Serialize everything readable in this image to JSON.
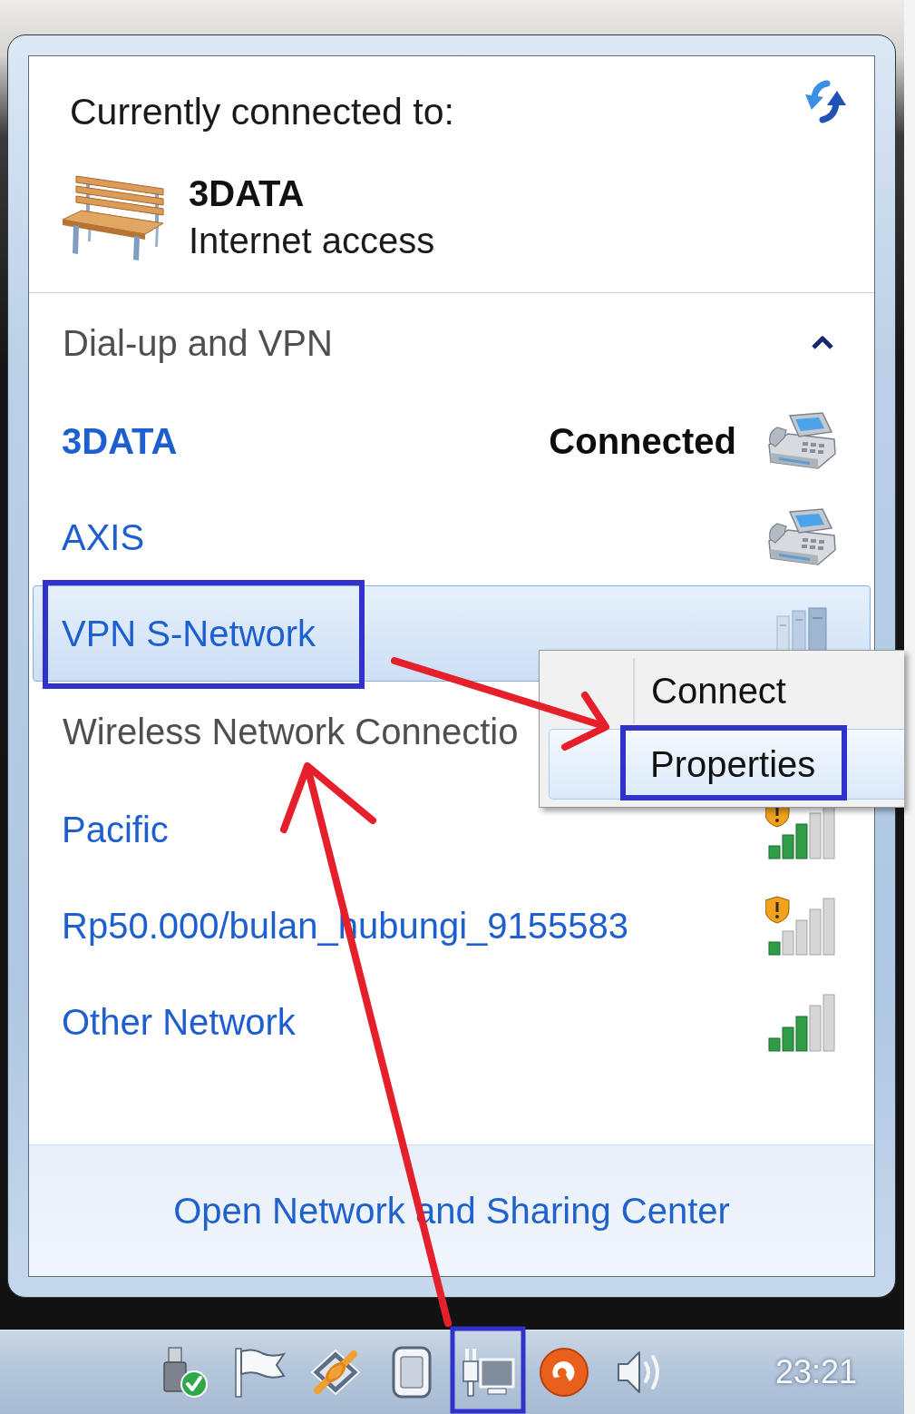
{
  "flyout": {
    "heading": "Currently connected to:",
    "current_connection": {
      "name": "3DATA",
      "access": "Internet access"
    },
    "sections": [
      {
        "title": "Dial-up and VPN",
        "expanded": true,
        "items": [
          {
            "kind": "dialup",
            "name": "3DATA",
            "connected": true,
            "status": "Connected",
            "selected": false
          },
          {
            "kind": "dialup",
            "name": "AXIS",
            "connected": false,
            "selected": false
          },
          {
            "kind": "vpn",
            "name": "VPN S-Network",
            "connected": false,
            "selected": true
          }
        ]
      },
      {
        "title": "Wireless Network Connectio",
        "items": [
          {
            "kind": "wifi-medium",
            "name": "Pacific",
            "connected": false,
            "selected": false,
            "unsecured": true
          },
          {
            "kind": "wifi-low",
            "name": "Rp50.000/bulan_hubungi_9155583",
            "connected": false,
            "selected": false,
            "unsecured": true
          },
          {
            "kind": "wifi-medium",
            "name": "Other Network",
            "connected": false,
            "selected": false,
            "unsecured": false
          }
        ]
      }
    ],
    "footer_link": "Open Network and Sharing Center"
  },
  "context_menu": {
    "items": [
      {
        "label": "Connect",
        "selected": false
      },
      {
        "label": "Properties",
        "selected": true
      }
    ]
  },
  "taskbar": {
    "clock": "23:21"
  }
}
